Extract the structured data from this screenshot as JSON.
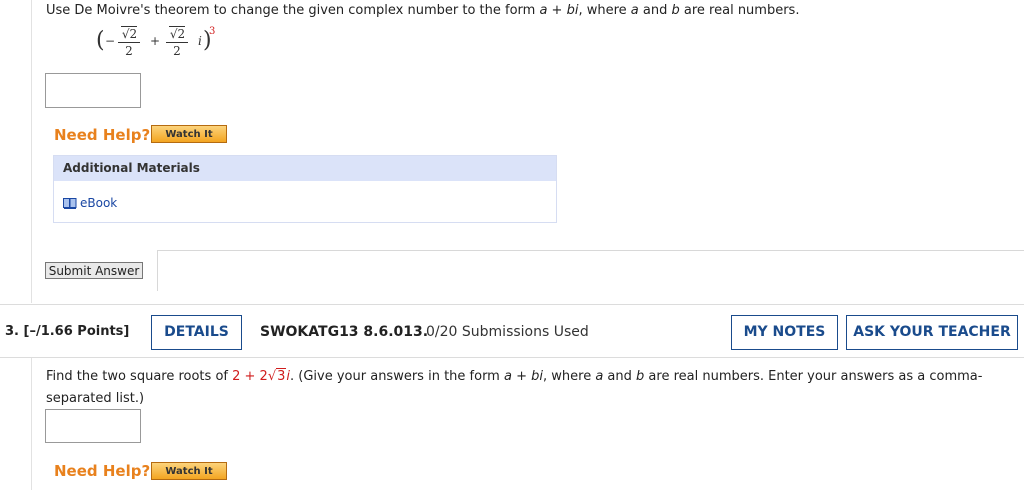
{
  "q2": {
    "instruction_pre": "Use De Moivre's theorem to change the given complex number to the form ",
    "form_a": "a",
    "plus": " + ",
    "form_bi": "bi",
    "instruction_mid": ", where ",
    "var_a": "a",
    "and": " and ",
    "var_b": "b",
    "instruction_end": " are real numbers.",
    "math": {
      "minus": "−",
      "num": "√2",
      "den": "2",
      "plus": "+",
      "i": "i",
      "exponent": "3"
    },
    "need_help": "Need Help?",
    "watch_it": "Watch It",
    "additional_materials": "Additional Materials",
    "ebook": "eBook",
    "submit": "Submit Answer"
  },
  "q3": {
    "number": "3.  [–/1.66 Points]",
    "details": "DETAILS",
    "code": "SWOKATG13 8.6.013.",
    "submissions": "0/20 Submissions Used",
    "my_notes": "MY NOTES",
    "ask_teacher": "ASK YOUR TEACHER",
    "text_pre": "Find the two square roots of ",
    "expr_a": "2 + 2",
    "expr_rad": "3",
    "expr_i": "i",
    "text_post": ".  (Give your answers in the form ",
    "form_a": "a",
    "plus": " + ",
    "form_bi": "bi",
    "where": ", where ",
    "var_a": "a",
    "and": " and ",
    "var_b": "b",
    "text_end": " are real numbers. Enter your answers as a comma-separated list.)",
    "need_help": "Need Help?",
    "watch_it": "Watch It"
  },
  "colors": {
    "accent_orange": "#e8811d",
    "link_blue": "#1a47a3",
    "button_navy": "#1a4b8c",
    "math_red": "#d01c1c"
  },
  "icons": {
    "ebook": "book-icon"
  }
}
